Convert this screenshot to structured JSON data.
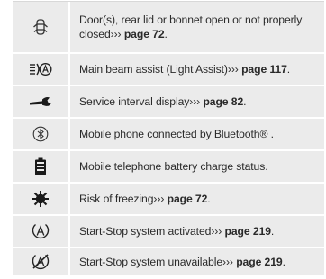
{
  "rows": [
    {
      "icon": "door-open-icon",
      "text": "Door(s), rear lid or bonnet open or not properly closed",
      "arrow": "›››",
      "ref": "page 72",
      "end": "."
    },
    {
      "icon": "main-beam-assist-icon",
      "text": "Main beam assist (Light Assist)",
      "arrow": "›››",
      "ref": "page 117",
      "end": "."
    },
    {
      "icon": "wrench-icon",
      "text": "Service interval display",
      "arrow": "›››",
      "ref": "page 82",
      "end": "."
    },
    {
      "icon": "bluetooth-icon",
      "text": "Mobile phone connected by Bluetooth® .",
      "arrow": "",
      "ref": "",
      "end": ""
    },
    {
      "icon": "battery-icon",
      "text": "Mobile telephone battery charge status.",
      "arrow": "",
      "ref": "",
      "end": ""
    },
    {
      "icon": "snowflake-icon",
      "text": "Risk of freezing",
      "arrow": "›››",
      "ref": "page 72",
      "end": "."
    },
    {
      "icon": "start-stop-icon",
      "text": "Start-Stop system activated",
      "arrow": "›››",
      "ref": "page 219",
      "end": "."
    },
    {
      "icon": "start-stop-unavailable-icon",
      "text": "Start-Stop system unavailable",
      "arrow": "›››",
      "ref": "page 219",
      "end": "."
    }
  ]
}
